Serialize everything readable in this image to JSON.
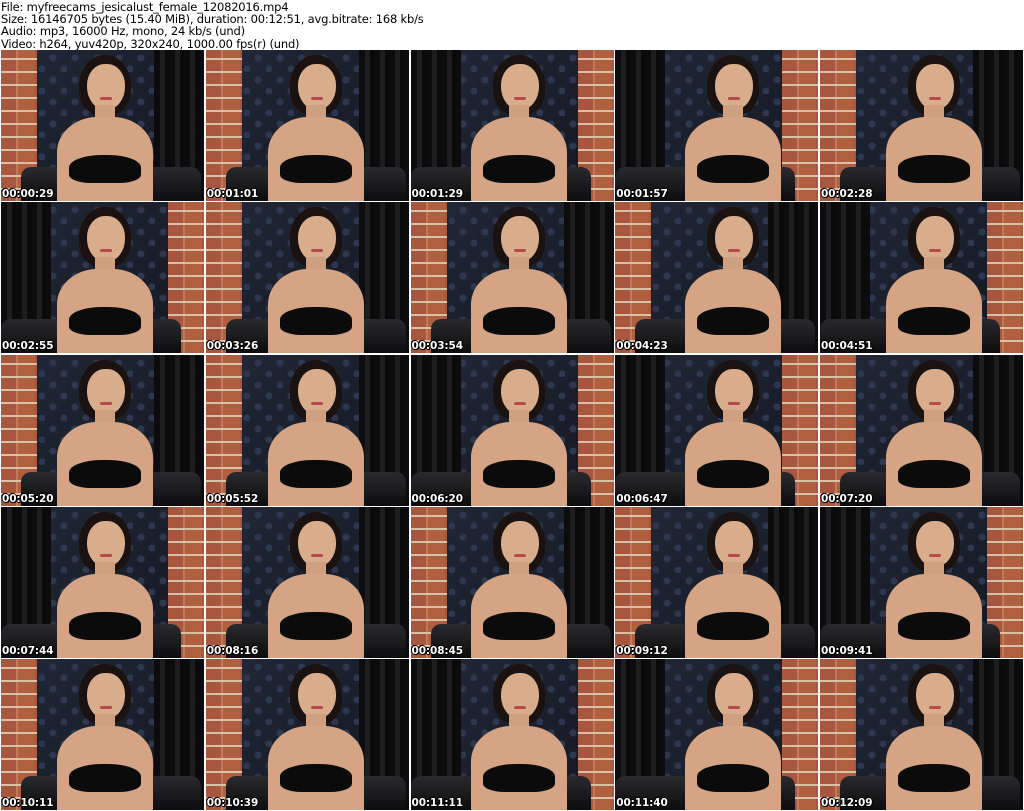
{
  "header": {
    "file": "File: myfreecams_jesicalust_female_12082016.mp4",
    "size": "Size: 16146705 bytes (15.40 MiB), duration: 00:12:51, avg.bitrate: 168 kb/s",
    "audio": "Audio: mp3, 16000 Hz, mono, 24 kb/s (und)",
    "video": "Video: h264, yuv420p, 320x240, 1000.00 fps(r) (und)"
  },
  "thumbnails": [
    {
      "time": "00:00:29"
    },
    {
      "time": "00:01:01"
    },
    {
      "time": "00:01:29"
    },
    {
      "time": "00:01:57"
    },
    {
      "time": "00:02:28"
    },
    {
      "time": "00:02:55"
    },
    {
      "time": "00:03:26"
    },
    {
      "time": "00:03:54"
    },
    {
      "time": "00:04:23"
    },
    {
      "time": "00:04:51"
    },
    {
      "time": "00:05:20"
    },
    {
      "time": "00:05:52"
    },
    {
      "time": "00:06:20"
    },
    {
      "time": "00:06:47"
    },
    {
      "time": "00:07:20"
    },
    {
      "time": "00:07:44"
    },
    {
      "time": "00:08:16"
    },
    {
      "time": "00:08:45"
    },
    {
      "time": "00:09:12"
    },
    {
      "time": "00:09:41"
    },
    {
      "time": "00:10:11"
    },
    {
      "time": "00:10:39"
    },
    {
      "time": "00:11:11"
    },
    {
      "time": "00:11:40"
    },
    {
      "time": "00:12:09"
    }
  ]
}
